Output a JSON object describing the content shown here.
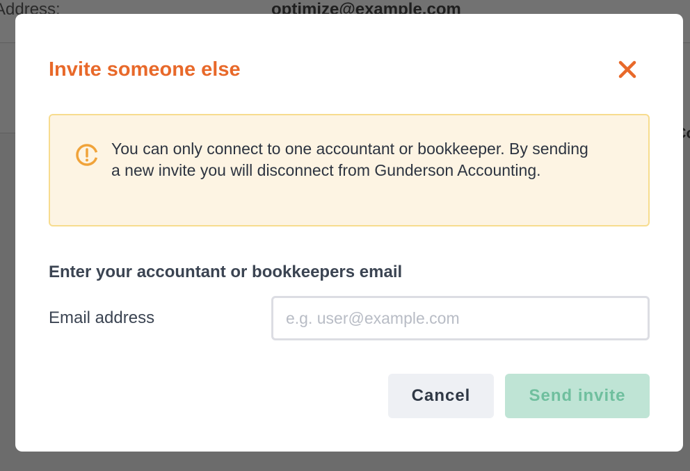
{
  "background": {
    "label": "Address:",
    "value": "optimize@example.com",
    "edge_text": "Co"
  },
  "modal": {
    "title": "Invite someone else",
    "close_icon": "close-icon",
    "warning": {
      "icon": "warning-circle-icon",
      "text": "You can only connect to one accountant or bookkeeper. By sending a new invite you will disconnect from Gunderson Accounting."
    },
    "section_heading": "Enter your accountant or bookkeepers email",
    "email_label": "Email address",
    "email_value": "",
    "email_placeholder": "e.g. user@example.com",
    "cancel_label": "Cancel",
    "send_label": "Send invite"
  },
  "colors": {
    "accent": "#e8692a",
    "warning_bg": "#fdf4e3",
    "warning_border": "#f7dc8e",
    "warning_icon": "#f0a33a",
    "send_disabled_bg": "#bfe4d5",
    "send_disabled_text": "#6fbf9e"
  }
}
